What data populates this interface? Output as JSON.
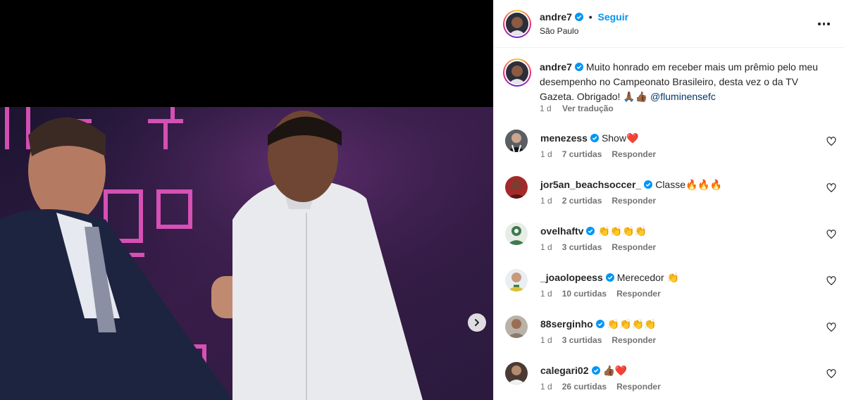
{
  "post": {
    "username": "andre7",
    "follow_label": "Seguir",
    "separator": "•",
    "location": "São Paulo",
    "caption_text": "Muito honrado em receber mais um prêmio pelo meu desempenho no Campeonato Brasileiro, desta vez o da TV Gazeta. Obrigado! 🙏🏾👍🏾 ",
    "caption_mention": "@fluminensefc",
    "caption_time": "1 d",
    "translate_label": "Ver tradução"
  },
  "comments": [
    {
      "username": "menezess",
      "text": "Show❤️",
      "time": "1 d",
      "likes": "7 curtidas",
      "reply": "Responder",
      "avatar_color": "#5a5f63"
    },
    {
      "username": "jor5an_beachsoccer_",
      "text": "Classe🔥🔥🔥",
      "time": "1 d",
      "likes": "2 curtidas",
      "reply": "Responder",
      "avatar_color": "#a32a2a"
    },
    {
      "username": "ovelhaftv",
      "text": "👏👏👏👏",
      "time": "1 d",
      "likes": "3 curtidas",
      "reply": "Responder",
      "avatar_color": "#3d7a4e"
    },
    {
      "username": "_joaolopeess",
      "text": "Merecedor 👏",
      "time": "1 d",
      "likes": "10 curtidas",
      "reply": "Responder",
      "avatar_color": "#d9c23a"
    },
    {
      "username": "88serginho",
      "text": "👏👏👏👏",
      "time": "1 d",
      "likes": "3 curtidas",
      "reply": "Responder",
      "avatar_color": "#8a7b6c"
    },
    {
      "username": "calegari02",
      "text": "👍🏾❤️",
      "time": "1 d",
      "likes": "26 curtidas",
      "reply": "Responder",
      "avatar_color": "#6a5446"
    }
  ],
  "colors": {
    "accent": "#0095f6",
    "verified": "#0095f6",
    "muted": "#737373",
    "mention": "#00376b"
  },
  "icons": {
    "verified": "verified-badge-icon",
    "more": "more-options-icon",
    "heart": "heart-outline-icon",
    "next": "chevron-right-icon"
  }
}
